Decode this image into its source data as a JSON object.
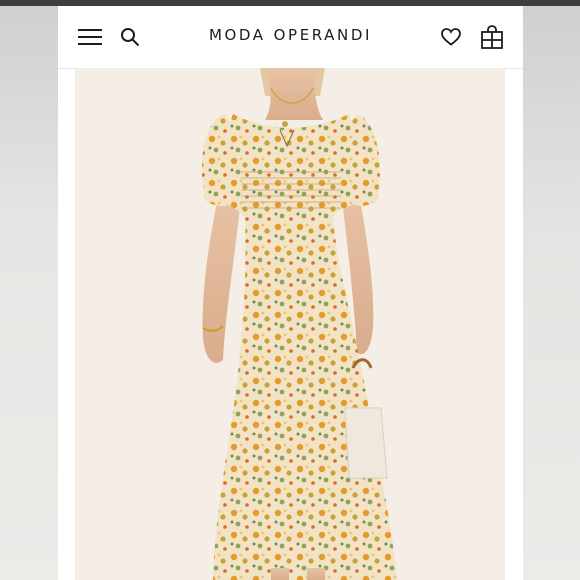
{
  "header": {
    "brand_left": "MODA",
    "brand_right": "OPERANDI"
  },
  "icons": {
    "menu": "menu-icon",
    "search": "search-icon",
    "wishlist": "heart-icon",
    "bag": "shopping-bag-icon"
  },
  "colors": {
    "top_bar": "#3e3e3e",
    "brand_text": "#1d1d1d",
    "photo_background": "#f4eee7",
    "dress_base": "#f2e3c4",
    "floral_orange": "#e59a2c"
  }
}
